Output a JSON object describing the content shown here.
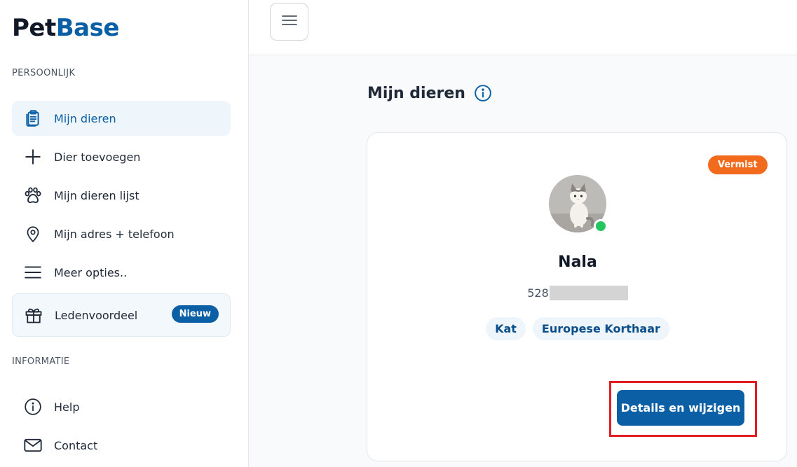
{
  "brand": {
    "name_part1": "Pet",
    "name_part2": "Base"
  },
  "sidebar": {
    "section_personal": "PERSOONLIJK",
    "section_info": "INFORMATIE",
    "items": [
      {
        "label": "Mijn dieren",
        "icon": "clipboard-icon"
      },
      {
        "label": "Dier toevoegen",
        "icon": "plus-icon"
      },
      {
        "label": "Mijn dieren lijst",
        "icon": "paw-icon"
      },
      {
        "label": "Mijn adres + telefoon",
        "icon": "location-pin-icon"
      },
      {
        "label": "Meer opties..",
        "icon": "hamburger-icon"
      },
      {
        "label": "Ledenvoordeel",
        "icon": "gift-icon",
        "badge": "Nieuw"
      }
    ],
    "info_items": [
      {
        "label": "Help",
        "icon": "info-circle-icon"
      },
      {
        "label": "Contact",
        "icon": "mail-icon"
      }
    ]
  },
  "main": {
    "title": "Mijn dieren",
    "pet": {
      "status": "Vermist",
      "name": "Nala",
      "chip_prefix": "528",
      "tags": [
        "Kat",
        "Europese Korthaar"
      ],
      "button": "Details en wijzigen"
    }
  },
  "colors": {
    "primary": "#0b5fa5",
    "status_missing": "#f26b1d",
    "online": "#22c55e",
    "highlight": "#e31b23"
  }
}
